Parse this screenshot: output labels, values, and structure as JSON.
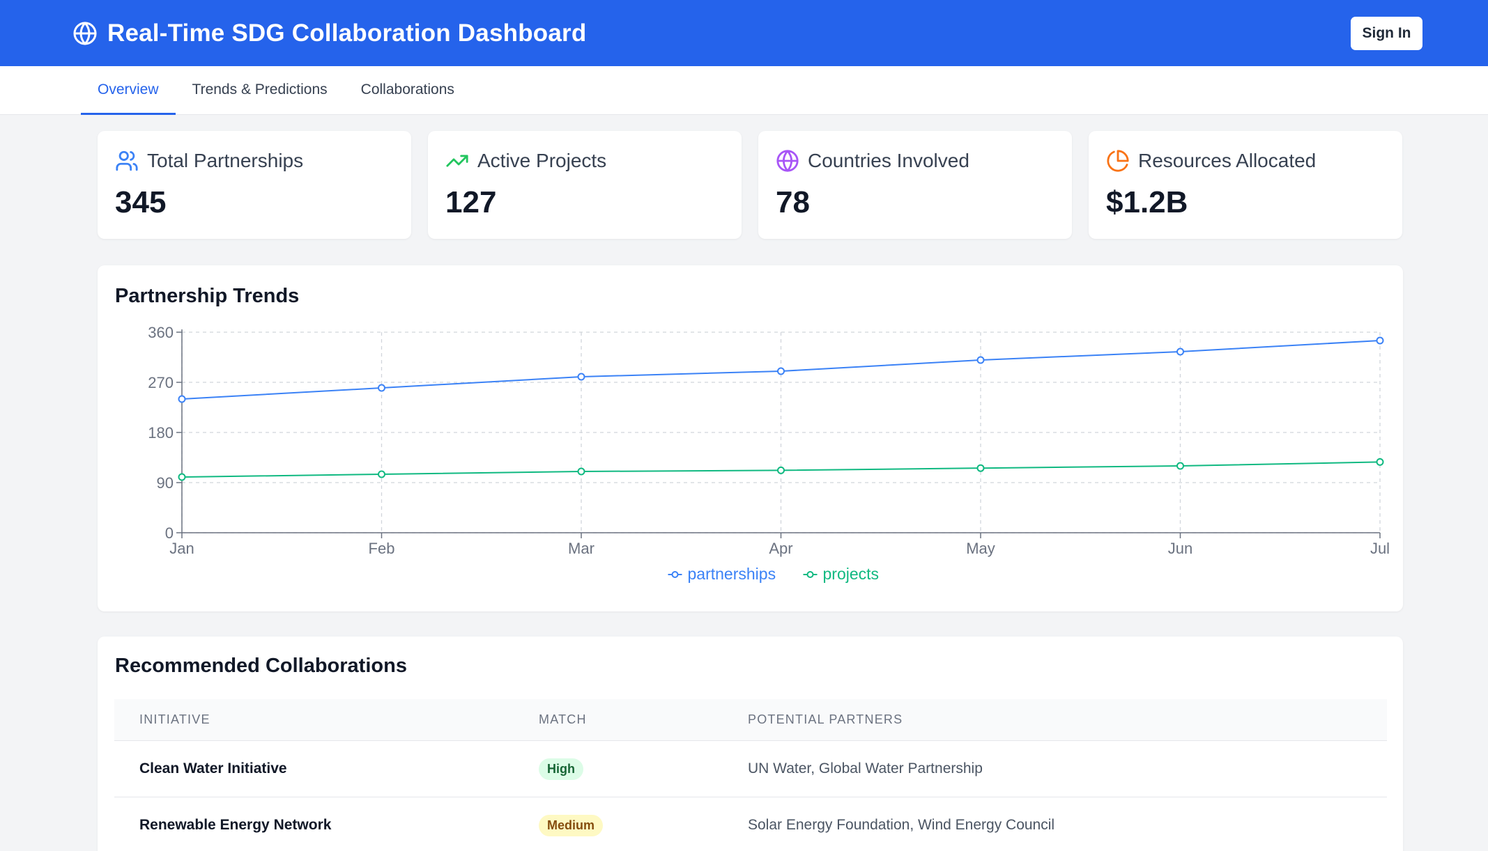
{
  "header": {
    "title": "Real-Time SDG Collaboration Dashboard",
    "signin_label": "Sign In"
  },
  "tabs": [
    {
      "label": "Overview",
      "active": true
    },
    {
      "label": "Trends & Predictions",
      "active": false
    },
    {
      "label": "Collaborations",
      "active": false
    }
  ],
  "stats": [
    {
      "label": "Total Partnerships",
      "value": "345",
      "icon": "users-icon",
      "color": "#3b82f6"
    },
    {
      "label": "Active Projects",
      "value": "127",
      "icon": "trending-up-icon",
      "color": "#22c55e"
    },
    {
      "label": "Countries Involved",
      "value": "78",
      "icon": "globe-icon",
      "color": "#a855f7"
    },
    {
      "label": "Resources Allocated",
      "value": "$1.2B",
      "icon": "pie-chart-icon",
      "color": "#f97316"
    }
  ],
  "trends": {
    "title": "Partnership Trends",
    "chart_data": {
      "type": "line",
      "categories": [
        "Jan",
        "Feb",
        "Mar",
        "Apr",
        "May",
        "Jun",
        "Jul"
      ],
      "series": [
        {
          "name": "partnerships",
          "color": "#3b82f6",
          "values": [
            240,
            260,
            280,
            290,
            310,
            325,
            345
          ]
        },
        {
          "name": "projects",
          "color": "#10b981",
          "values": [
            100,
            105,
            110,
            112,
            116,
            120,
            127
          ]
        }
      ],
      "yticks": [
        "0",
        "90",
        "180",
        "270",
        "360"
      ],
      "ylim": [
        0,
        360
      ],
      "grid": true,
      "legend": "bottom-center"
    }
  },
  "collaborations": {
    "title": "Recommended Collaborations",
    "columns": [
      "INITIATIVE",
      "MATCH",
      "POTENTIAL PARTNERS"
    ],
    "rows": [
      {
        "initiative": "Clean Water Initiative",
        "match": "High",
        "match_bg": "#dcfce7",
        "match_color": "#166534",
        "partners": "UN Water, Global Water Partnership"
      },
      {
        "initiative": "Renewable Energy Network",
        "match": "Medium",
        "match_bg": "#fef9c3",
        "match_color": "#854d0e",
        "partners": "Solar Energy Foundation, Wind Energy Council"
      }
    ]
  }
}
